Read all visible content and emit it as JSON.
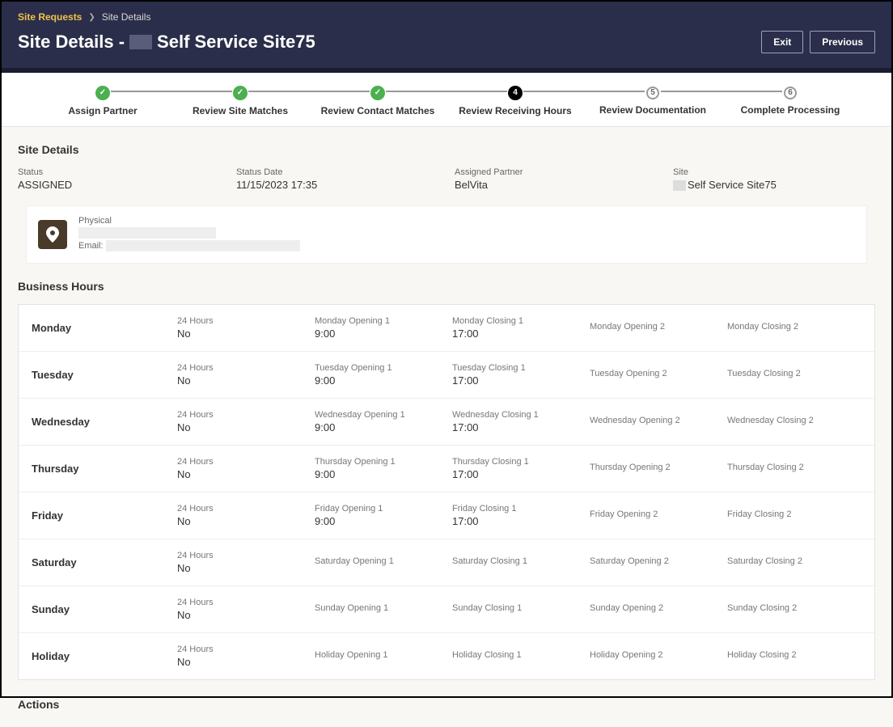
{
  "breadcrumb": {
    "root": "Site Requests",
    "current": "Site Details"
  },
  "header": {
    "title_prefix": "Site Details -",
    "title_suffix": "Self Service Site75",
    "exit": "Exit",
    "previous": "Previous"
  },
  "progress": {
    "steps": [
      {
        "label": "Assign Partner",
        "state": "done"
      },
      {
        "label": "Review Site Matches",
        "state": "done"
      },
      {
        "label": "Review Contact Matches",
        "state": "done"
      },
      {
        "label": "Review Receiving Hours",
        "state": "current",
        "num": "4"
      },
      {
        "label": "Review Documentation",
        "state": "pending",
        "num": "5"
      },
      {
        "label": "Complete Processing",
        "state": "pending",
        "num": "6"
      }
    ]
  },
  "sections": {
    "site_details_title": "Site Details",
    "business_hours_title": "Business Hours",
    "actions_title": "Actions"
  },
  "details": {
    "status_label": "Status",
    "status_value": "ASSIGNED",
    "status_date_label": "Status Date",
    "status_date_value": "11/15/2023 17:35",
    "assigned_partner_label": "Assigned Partner",
    "assigned_partner_value": "BelVita",
    "site_label": "Site",
    "site_value": "Self Service Site75"
  },
  "contact": {
    "physical_label": "Physical",
    "email_label": "Email:"
  },
  "hours_labels": {
    "h24": "24 Hours"
  },
  "hours": [
    {
      "day": "Monday",
      "h24": "No",
      "o1l": "Monday Opening 1",
      "o1": "9:00",
      "c1l": "Monday Closing 1",
      "c1": "17:00",
      "o2l": "Monday Opening 2",
      "o2": "",
      "c2l": "Monday Closing 2",
      "c2": ""
    },
    {
      "day": "Tuesday",
      "h24": "No",
      "o1l": "Tuesday Opening 1",
      "o1": "9:00",
      "c1l": "Tuesday Closing 1",
      "c1": "17:00",
      "o2l": "Tuesday Opening 2",
      "o2": "",
      "c2l": "Tuesday Closing 2",
      "c2": ""
    },
    {
      "day": "Wednesday",
      "h24": "No",
      "o1l": "Wednesday Opening 1",
      "o1": "9:00",
      "c1l": "Wednesday Closing 1",
      "c1": "17:00",
      "o2l": "Wednesday Opening 2",
      "o2": "",
      "c2l": "Wednesday Closing 2",
      "c2": ""
    },
    {
      "day": "Thursday",
      "h24": "No",
      "o1l": "Thursday Opening 1",
      "o1": "9:00",
      "c1l": "Thursday Closing 1",
      "c1": "17:00",
      "o2l": "Thursday Opening 2",
      "o2": "",
      "c2l": "Thursday Closing 2",
      "c2": ""
    },
    {
      "day": "Friday",
      "h24": "No",
      "o1l": "Friday Opening 1",
      "o1": "9:00",
      "c1l": "Friday Closing 1",
      "c1": "17:00",
      "o2l": "Friday Opening 2",
      "o2": "",
      "c2l": "Friday Closing 2",
      "c2": ""
    },
    {
      "day": "Saturday",
      "h24": "No",
      "o1l": "Saturday Opening 1",
      "o1": "",
      "c1l": "Saturday Closing 1",
      "c1": "",
      "o2l": "Saturday Opening 2",
      "o2": "",
      "c2l": "Saturday Closing 2",
      "c2": ""
    },
    {
      "day": "Sunday",
      "h24": "No",
      "o1l": "Sunday Opening 1",
      "o1": "",
      "c1l": "Sunday Closing 1",
      "c1": "",
      "o2l": "Sunday Opening 2",
      "o2": "",
      "c2l": "Sunday Closing 2",
      "c2": ""
    },
    {
      "day": "Holiday",
      "h24": "No",
      "o1l": "Holiday Opening 1",
      "o1": "",
      "c1l": "Holiday Closing 1",
      "c1": "",
      "o2l": "Holiday Opening 2",
      "o2": "",
      "c2l": "Holiday Closing 2",
      "c2": ""
    }
  ]
}
